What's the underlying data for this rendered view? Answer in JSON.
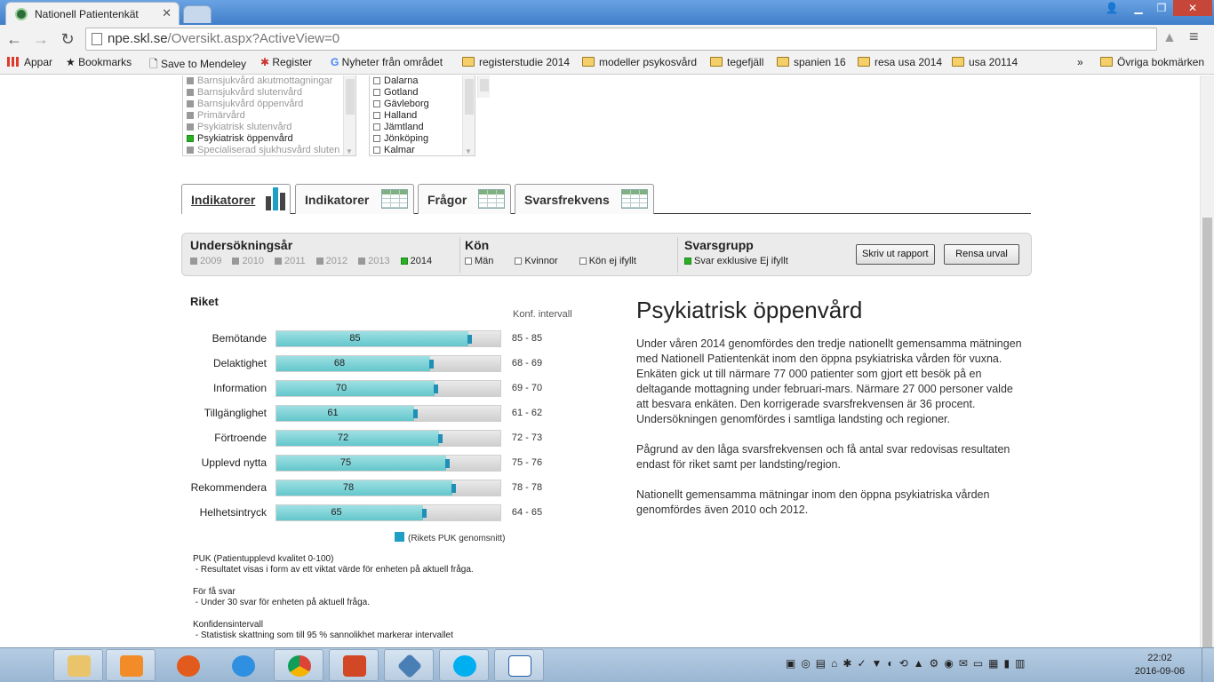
{
  "browser": {
    "tab_title": "Nationell Patientenkät",
    "url_host": "npe.skl.se",
    "url_path": "/Oversikt.aspx?ActiveView=0",
    "bookmarks": [
      {
        "label": "Appar"
      },
      {
        "label": "Bookmarks"
      },
      {
        "label": "Save to Mendeley"
      },
      {
        "label": "Register"
      },
      {
        "label": "Nyheter från området"
      },
      {
        "label": "registerstudie 2014"
      },
      {
        "label": "modeller psykosvård"
      },
      {
        "label": "tegefjäll"
      },
      {
        "label": "spanien 16"
      },
      {
        "label": "resa usa 2014"
      },
      {
        "label": "usa 20114"
      }
    ],
    "more_bookmarks": "»",
    "other_bookmarks": "Övriga bokmärken"
  },
  "areas": [
    {
      "label": "Barnsjukvård akutmottagningar",
      "state": "off"
    },
    {
      "label": "Barnsjukvård slutenvård",
      "state": "off"
    },
    {
      "label": "Barnsjukvård öppenvård",
      "state": "off"
    },
    {
      "label": "Primärvård",
      "state": "off"
    },
    {
      "label": "Psykiatrisk slutenvård",
      "state": "off"
    },
    {
      "label": "Psykiatrisk öppenvård",
      "state": "on"
    },
    {
      "label": "Specialiserad sjukhusvård sluten",
      "state": "off"
    }
  ],
  "regions": [
    {
      "label": "Dalarna"
    },
    {
      "label": "Gotland"
    },
    {
      "label": "Gävleborg"
    },
    {
      "label": "Halland"
    },
    {
      "label": "Jämtland"
    },
    {
      "label": "Jönköping"
    },
    {
      "label": "Kalmar"
    }
  ],
  "tabs": [
    {
      "label": "Indikatorer",
      "active": true,
      "icon": "bar-chart-icon"
    },
    {
      "label": "Indikatorer",
      "active": false,
      "icon": "table-icon"
    },
    {
      "label": "Frågor",
      "active": false,
      "icon": "table-icon"
    },
    {
      "label": "Svarsfrekvens",
      "active": false,
      "icon": "table-icon"
    }
  ],
  "filters": {
    "year_title": "Undersökningsår",
    "years": [
      {
        "label": "2009",
        "state": "off"
      },
      {
        "label": "2010",
        "state": "off"
      },
      {
        "label": "2011",
        "state": "off"
      },
      {
        "label": "2012",
        "state": "off"
      },
      {
        "label": "2013",
        "state": "off"
      },
      {
        "label": "2014",
        "state": "on"
      }
    ],
    "gender_title": "Kön",
    "genders": [
      {
        "label": "Män"
      },
      {
        "label": "Kvinnor"
      },
      {
        "label": "Kön ej ifyllt"
      }
    ],
    "group_title": "Svarsgrupp",
    "group_option": "Svar exklusive Ej ifyllt",
    "print_button": "Skriv ut rapport",
    "clear_button": "Rensa urval"
  },
  "results": {
    "title": "Riket",
    "ci_header": "Konf. intervall",
    "legend": "(Rikets PUK genomsnitt)"
  },
  "chart_data": {
    "type": "bar",
    "orientation": "horizontal",
    "xlim": [
      0,
      100
    ],
    "categories": [
      "Bemötande",
      "Delaktighet",
      "Information",
      "Tillgänglighet",
      "Förtroende",
      "Upplevd nytta",
      "Rekommendera",
      "Helhetsintryck"
    ],
    "values": [
      85,
      68,
      70,
      61,
      72,
      75,
      78,
      65
    ],
    "national_average": [
      85,
      68,
      70,
      61,
      72,
      75,
      78,
      65
    ],
    "confidence_intervals": [
      "85 - 85",
      "68 - 69",
      "69 - 70",
      "61 - 62",
      "72 - 73",
      "75 - 76",
      "78 - 78",
      "64 - 65"
    ],
    "bar_color": "#63c7cc",
    "marker_color": "#1f8fb6"
  },
  "notes": {
    "puk_title": "PUK (Patientupplevd kvalitet 0-100)",
    "puk_text": " - Resultatet visas i form av ett viktat värde för enheten på aktuell fråga.",
    "few_title": "För få svar",
    "few_text": " - Under 30 svar för enheten på aktuell fråga.",
    "ci_title": "Konfidensintervall",
    "ci_text": " - Statistisk skattning som till 95 % sannolikhet markerar intervallet"
  },
  "article": {
    "heading": "Psykiatrisk öppenvård",
    "p1": "Under våren 2014 genomfördes den tredje nationellt gemensamma mätningen med Nationell Patientenkät inom den öppna psykiatriska vården för vuxna. Enkäten gick ut till närmare 77 000 patienter som gjort ett besök på en deltagande mottagning under februari-mars. Närmare 27 000 personer valde att besvara enkäten.  Den korrigerade svarsfrekvensen är 36 procent. Undersökningen genomfördes  i samtliga landsting och regioner.",
    "p2": "Pågrund av den låga svarsfrekvensen och få antal svar redovisas resultaten endast för riket samt per landsting/region.",
    "p3": "Nationellt gemensamma mätningar inom den öppna psykiatriska vården genomfördes även 2010 och 2012."
  },
  "taskbar": {
    "time": "22:02",
    "date": "2016-09-06"
  }
}
